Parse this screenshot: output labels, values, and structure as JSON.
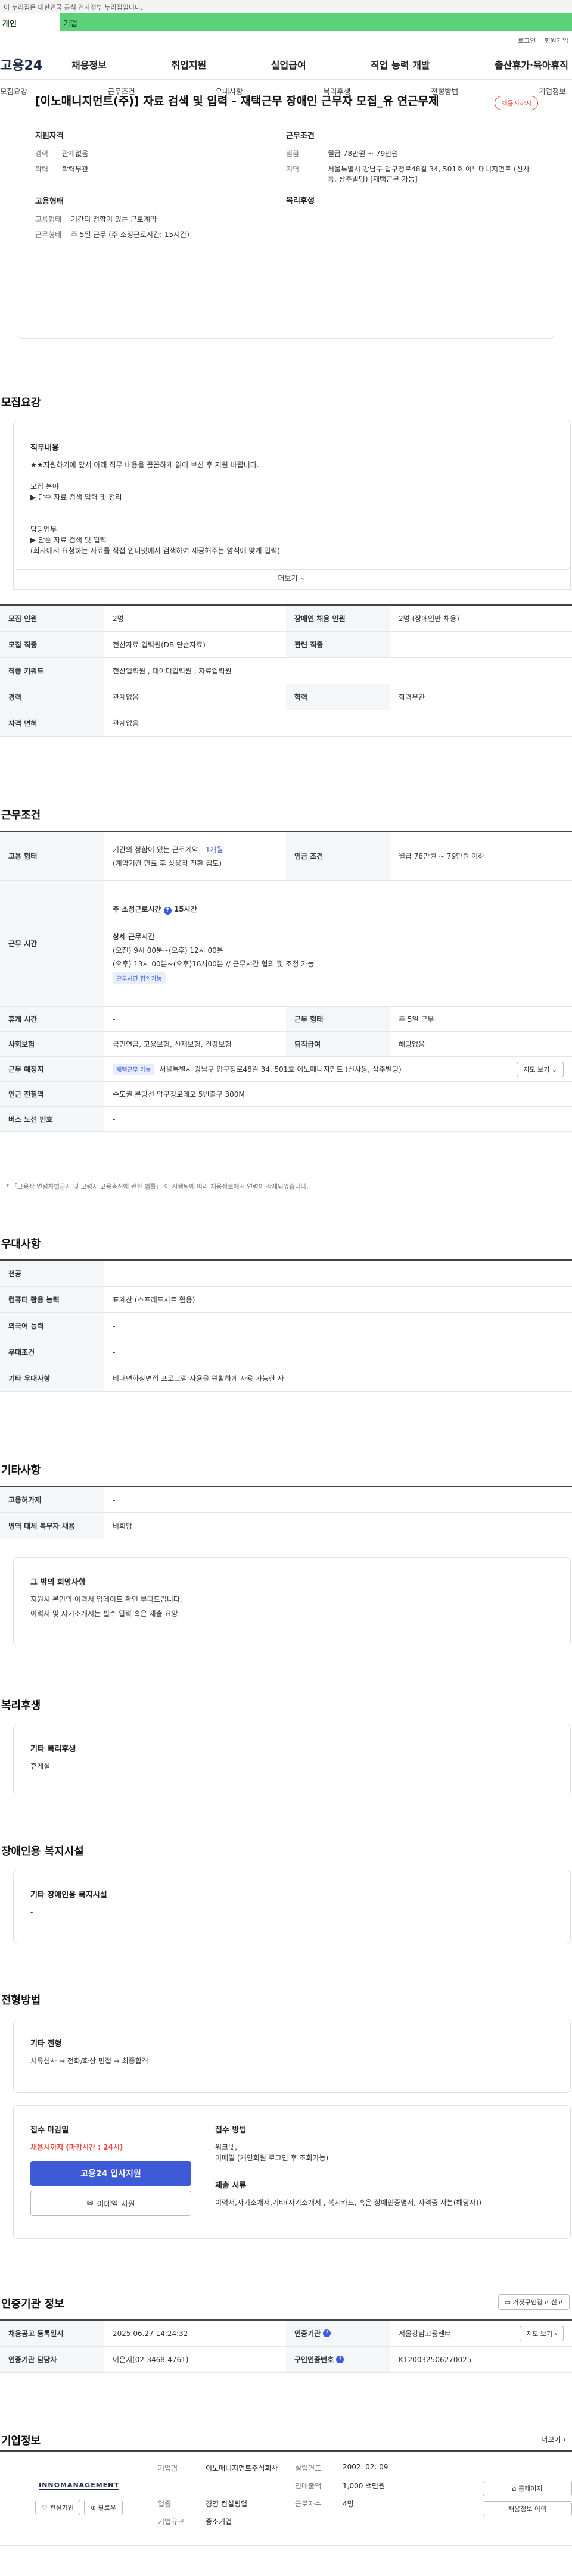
{
  "gov_notice": "이 누리집은 대한민국 공식 전자정부 누리집입니다.",
  "top_tabs": [
    "개인",
    "기업"
  ],
  "util": [
    "로그인",
    "회원가입"
  ],
  "logo": "고용24",
  "gnb": [
    "채용정보",
    "취업지원",
    "실업급여",
    "직업 능력 개발",
    "출산휴가·육아휴직"
  ],
  "sub_tabs": [
    "모집요강",
    "근무조건",
    "우대사항",
    "복리후생",
    "전형방법",
    "기업정보"
  ],
  "title": "[이노매니지먼트(주)] 자료 검색 및 입력 - 재택근무 장애인 근무자 모집_유 연근무제",
  "deadline_badge": "채용시까지",
  "summary": {
    "qual_title": "지원자격",
    "career_k": "경력",
    "career_v": "관계없음",
    "edu_k": "학력",
    "edu_v": "학력무관",
    "emp_title": "고용형태",
    "emptype_k": "고용형태",
    "emptype_v": "기간의 정함이 있는 근로계약",
    "worktype_k": "근무형태",
    "worktype_v": "주 5일 근무 (주 소정근로시간: 15시간)",
    "cond_title": "근무조건",
    "wage_k": "임금",
    "wage_v": "월급 78만원 ~ 79만원",
    "region_k": "지역",
    "region_v": "서울특별시 강남구 압구정로48길 34, 501호 이노매니지먼트 (신사동, 삼주빌딩) [재택근무 가능]",
    "welfare_title": "복리후생"
  },
  "recruit": {
    "section": "모집요강",
    "job_title": "직무내용",
    "line1": "★★지원하기에 앞서 아래 직무 내용을 꼼꼼하게 읽어 보신 후 지원 바랍니다.",
    "line2": "모집 분야",
    "line3": "▶ 단순 자료 검색 입력 및 정리",
    "line4": "담당업무",
    "line5": "▶ 단순 자료 검색 및 입력",
    "line6": "(회사에서 요청하는 자료를 직접 인터넷에서 검색하여 제공해주는 양식에 맞게 입력)",
    "more": "더보기"
  },
  "recruit_table": [
    {
      "k1": "모집 인원",
      "v1": "2명",
      "k2": "장애인 채용 인원",
      "v2": "2명 (장애인만 채용)"
    },
    {
      "k1": "모집 직종",
      "v1": "전산자료 입력원(DB 단순자료)",
      "k2": "관련 직종",
      "v2": "-"
    },
    {
      "k1": "직종 키워드",
      "v1": "전산입력원 , 데이터입력원 , 자료입력원"
    },
    {
      "k1": "경력",
      "v1": "관계없음",
      "k2": "학력",
      "v2": "학력무관"
    },
    {
      "k1": "자격 면허",
      "v1": "관계없음"
    }
  ],
  "cond": {
    "section": "근무조건",
    "emptype_k": "고용 형태",
    "emptype_v1": "기간의 정함이 있는 근로계약 -",
    "emptype_v1b": "1개월",
    "emptype_v2": "(계약기간 만료 후 상용직 전환 검토)",
    "wage_k": "임금 조건",
    "wage_v": "월급 78만원 ~ 79만원 이하",
    "hours_k": "근무 시간",
    "hours_title": "주 소정근로시간",
    "hours_num": "15시간",
    "detail_title": "상세 근무시간",
    "detail1": "(오전) 9시 00분~(오후) 12시 00분",
    "detail2": "(오후) 13시 00분~(오후)16시00분 // 근무시간 협의 및 조정 가능",
    "flex_chip": "근무시간 협의가능",
    "rest_k": "휴게 시간",
    "rest_v": "-",
    "form_k": "근무 형태",
    "form_v": "주 5일 근무",
    "ins_k": "사회보험",
    "ins_v": "국민연금, 고용보험, 산재보험, 건강보험",
    "sev_k": "퇴직급여",
    "sev_v": "해당없음",
    "place_k": "근무 예정지",
    "place_chip": "재택근무 가능",
    "place_v": "서울특별시 강남구 압구정로48길 34, 501호 이노매니지먼트 (신사동, 삼주빌딩)",
    "map_btn": "지도 보기",
    "sub_k": "인근 전철역",
    "sub_v": "수도권 분당선 압구정로데오 5번출구 300M",
    "bus_k": "버스 노선 번호",
    "bus_v": "-",
    "note": "* 「고용상 연령차별금지 및 고령자 고용촉진에 관한 법률」 이 시행됨에 따라 채용정보에서 연령이 삭제되었습니다."
  },
  "pref": {
    "section": "우대사항",
    "rows": [
      {
        "k": "전공",
        "v": "-"
      },
      {
        "k": "컴퓨터 활용 능력",
        "v": "표계산 (스프레드시트 활용)"
      },
      {
        "k": "외국어 능력",
        "v": "-"
      },
      {
        "k": "우대조건",
        "v": "-"
      },
      {
        "k": "기타 우대사항",
        "v": "비대면화상면접 프로그램 사용을 원활하게 사용 가능한 자"
      }
    ]
  },
  "etc": {
    "section": "기타사항",
    "rows": [
      {
        "k": "고용허가제",
        "v": "-"
      },
      {
        "k": "병역 대체 복무자 채용",
        "v": "비희망"
      }
    ],
    "box_title": "그 밖의 희망사항",
    "box_l1": "지원시 본인의 이력서 업데이트 확인 부탁드립니다.",
    "box_l2": "이력서 및 자기소개서는 필수 입력 혹은 제출 요망"
  },
  "welfare": {
    "section": "복리후생",
    "title": "기타 복리후생",
    "value": "휴게실"
  },
  "disab": {
    "section": "장애인용 복지시설",
    "title": "기타 장애인용 복지시설",
    "value": "-"
  },
  "process": {
    "section": "전형방법",
    "title": "기타 전형",
    "value": "서류심사 → 전화/화상 면접 → 최종합격",
    "deadline_title": "접수 마감일",
    "deadline_v": "채용시까지 (마감시간 : 24시)",
    "apply_btn": "고용24 입사지원",
    "email_btn": "이메일 지원",
    "method_title": "접수 방법",
    "method_v1": "워크넷,",
    "method_v2": "이메일 (개인회원 로그인 후 조회가능)",
    "docs_title": "제출 서류",
    "docs_v": "이력서,자기소개서,기타(자기소개서 , 복지카드, 혹은 장애인증명서, 자격증 사본(해당자))"
  },
  "agency": {
    "section": "인증기관 정보",
    "report_btn": "거짓구인광고 신고",
    "reg_k": "채용공고 등록일시",
    "reg_v": "2025.06.27 14:24:32",
    "org_k": "인증기관",
    "org_v": "서울강남고용센터",
    "map_btn": "지도 보기",
    "mgr_k": "인증기관 담당자",
    "mgr_v": "이은지(02-3468-4761)",
    "num_k": "구인인증번호",
    "num_v": "K120032506270025"
  },
  "company": {
    "section": "기업정보",
    "more": "더보기",
    "logo_text": "INNOMANAGEMENT",
    "fav_btn": "관심기업",
    "follow_btn": "팔로우",
    "name_k": "기업명",
    "name_v": "이노매니지먼트주식회사",
    "found_k": "설립연도",
    "found_v": "2002. 02. 09",
    "sales_k": "연매출액",
    "sales_v": "1,000 백만원",
    "ind_k": "업종",
    "ind_v": "경영 컨설팅업",
    "emp_k": "근로자수",
    "emp_v": "4명",
    "size_k": "기업규모",
    "size_v": "중소기업",
    "home_btn": "홈페이지",
    "list_btn": "채용정보 이력"
  },
  "colors": {
    "accent": "#3d5bd9",
    "green": "#5bd27a",
    "red": "#e8453c"
  }
}
